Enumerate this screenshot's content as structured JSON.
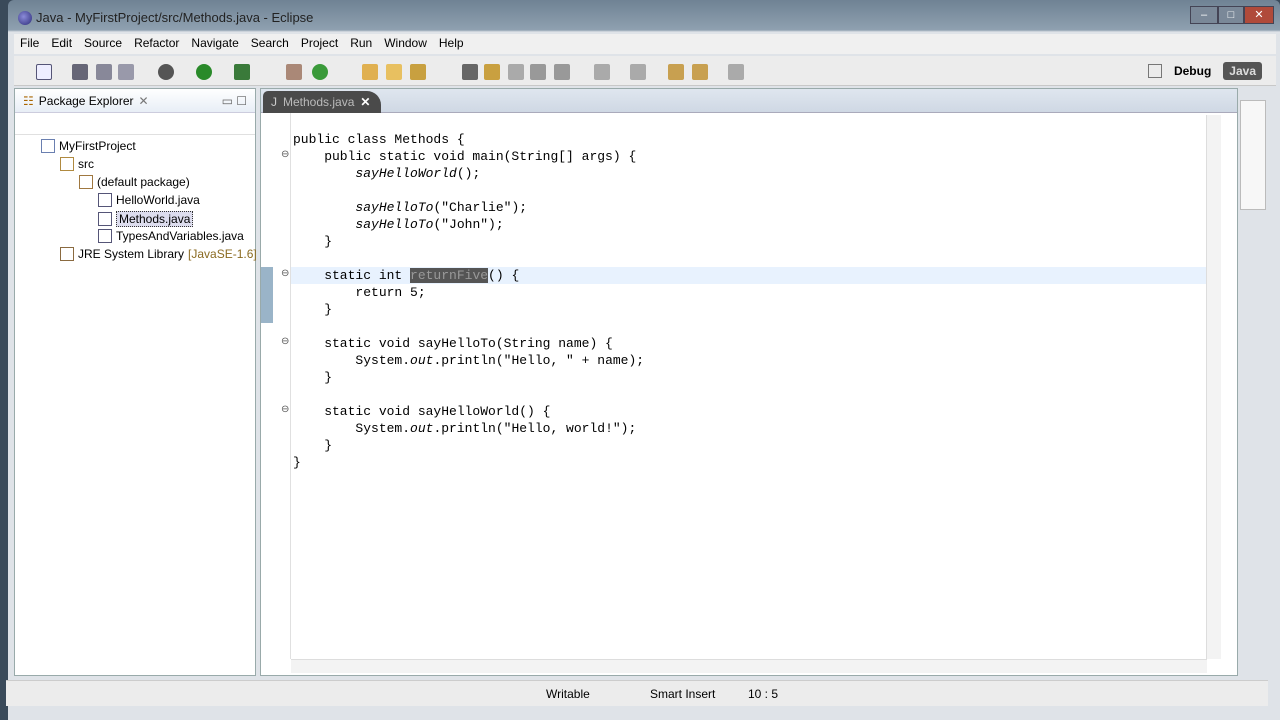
{
  "window": {
    "title": "Java - MyFirstProject/src/Methods.java - Eclipse",
    "minimize": "–",
    "maximize": "□",
    "close": "✕"
  },
  "menu": [
    "File",
    "Edit",
    "Source",
    "Refactor",
    "Navigate",
    "Search",
    "Project",
    "Run",
    "Window",
    "Help"
  ],
  "perspectives": {
    "debug": "Debug",
    "java": "Java"
  },
  "package_explorer": {
    "title": "Package Explorer",
    "items": [
      {
        "label": "MyFirstProject",
        "level": 0,
        "icon": "project-icon"
      },
      {
        "label": "src",
        "level": 1,
        "icon": "source-folder-icon"
      },
      {
        "label": "(default package)",
        "level": 2,
        "icon": "package-icon"
      },
      {
        "label": "HelloWorld.java",
        "level": 3,
        "icon": "java-file-icon"
      },
      {
        "label": "Methods.java",
        "level": 3,
        "icon": "java-file-icon",
        "selected": true
      },
      {
        "label": "TypesAndVariables.java",
        "level": 3,
        "icon": "java-file-icon"
      },
      {
        "label": "JRE System Library",
        "suffix": "[JavaSE-1.6]",
        "level": 1,
        "icon": "library-icon"
      }
    ]
  },
  "editor": {
    "tab": "Methods.java",
    "lines": [
      [
        [
          "",
          "public class Methods {"
        ]
      ],
      [
        [
          "",
          "    public static void main(String[] args) {"
        ]
      ],
      [
        [
          "",
          "        "
        ],
        [
          "it",
          "sayHelloWorld"
        ],
        [
          "",
          "();"
        ]
      ],
      [
        [
          "",
          ""
        ]
      ],
      [
        [
          "",
          "        "
        ],
        [
          "it",
          "sayHelloTo"
        ],
        [
          "",
          "(\"Charlie\");"
        ]
      ],
      [
        [
          "",
          "        "
        ],
        [
          "it",
          "sayHelloTo"
        ],
        [
          "",
          "(\"John\");"
        ]
      ],
      [
        [
          "",
          "    }"
        ]
      ],
      [
        [
          "",
          ""
        ]
      ],
      [
        [
          "",
          "    static int "
        ],
        [
          "sel",
          "returnFive"
        ],
        [
          "",
          "() {"
        ]
      ],
      [
        [
          "",
          "        return 5;"
        ]
      ],
      [
        [
          "",
          "    }"
        ]
      ],
      [
        [
          "",
          ""
        ]
      ],
      [
        [
          "",
          "    static void sayHelloTo(String name) {"
        ]
      ],
      [
        [
          "",
          "        System."
        ],
        [
          "it",
          "out"
        ],
        [
          "",
          ".println(\"Hello, \" + name);"
        ]
      ],
      [
        [
          "",
          "    }"
        ]
      ],
      [
        [
          "",
          ""
        ]
      ],
      [
        [
          "",
          "    static void sayHelloWorld() {"
        ]
      ],
      [
        [
          "",
          "        System."
        ],
        [
          "it",
          "out"
        ],
        [
          "",
          ".println(\"Hello, world!\");"
        ]
      ],
      [
        [
          "",
          "    }"
        ]
      ],
      [
        [
          "",
          "}"
        ]
      ]
    ],
    "fold_lines": [
      1,
      8,
      12,
      16
    ]
  },
  "status": {
    "writable": "Writable",
    "insert_mode": "Smart Insert",
    "position": "10 : 5"
  }
}
